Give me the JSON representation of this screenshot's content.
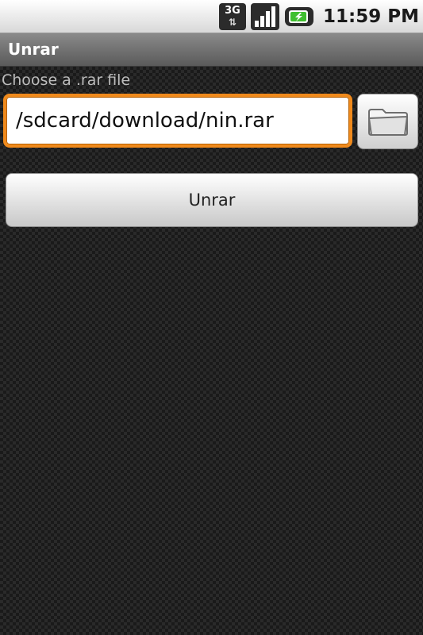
{
  "status_bar": {
    "network_type": "3G",
    "network_arrows": "⇅",
    "signal_icon": "signal-bars-icon",
    "battery_icon": "battery-charging-icon",
    "time": "11:59 PM"
  },
  "app": {
    "title": "Unrar"
  },
  "form": {
    "prompt": "Choose a .rar file",
    "path_value": "/sdcard/download/nin.rar",
    "browse_icon": "folder-icon",
    "unrar_label": "Unrar"
  },
  "colors": {
    "focus_border": "#f08a1c",
    "title_bar": "#6e6e6e",
    "background": "#1a1a1a"
  }
}
